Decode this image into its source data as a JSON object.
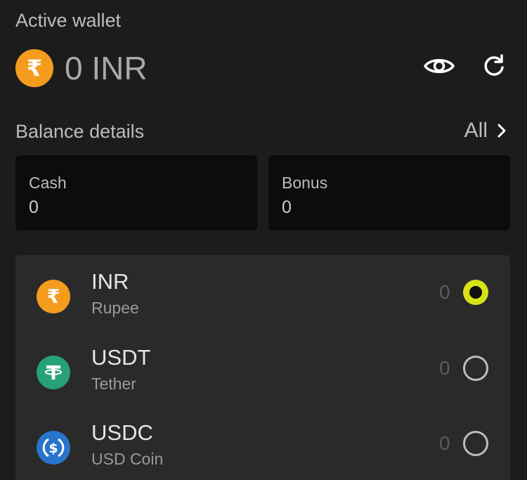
{
  "wallet": {
    "label": "Active wallet",
    "currency_symbol": "₹",
    "amount": "0 INR"
  },
  "balance": {
    "title": "Balance details",
    "all_label": "All",
    "cards": [
      {
        "label": "Cash",
        "value": "0"
      },
      {
        "label": "Bonus",
        "value": "0"
      }
    ]
  },
  "currencies": [
    {
      "code": "INR",
      "name": "Rupee",
      "balance": "0",
      "symbol": "₹",
      "selected": true,
      "color": "#f39c1e"
    },
    {
      "code": "USDT",
      "name": "Tether",
      "balance": "0",
      "symbol": "tether-icon",
      "selected": false,
      "color": "#27a17a"
    },
    {
      "code": "USDC",
      "name": "USD Coin",
      "balance": "0",
      "symbol": "usdc-icon",
      "selected": false,
      "color": "#2775ca"
    }
  ],
  "colors": {
    "background": "#1c1c1c",
    "card": "#0c0c0c",
    "panel": "#2a2a2a",
    "accent": "#d8e117"
  }
}
